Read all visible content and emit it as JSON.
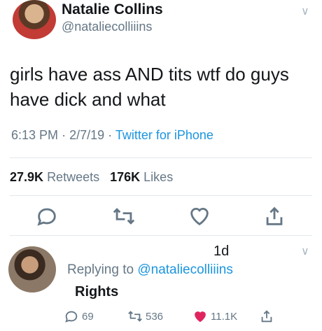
{
  "tweet": {
    "name": "Natalie Collins",
    "handle": "@nataliecolliiins",
    "text": "girls have ass AND tits wtf do guys have dick and what",
    "time": "6:13 PM",
    "sep1": "·",
    "date": "2/7/19",
    "sep2": "·",
    "source": "Twitter for iPhone",
    "retweets_count": "27.9K",
    "retweets_label": "Retweets",
    "likes_count": "176K",
    "likes_label": "Likes"
  },
  "reply": {
    "time": "1d",
    "replying_to_label": "Replying to",
    "replying_to_handle": "@nataliecolliiins",
    "text": "Rights",
    "reply_count": "69",
    "retweet_count": "536",
    "like_count": "11.1K"
  },
  "icons": [
    "reply-icon",
    "retweet-icon",
    "like-icon",
    "share-icon",
    "chevron-down-icon"
  ],
  "colors": {
    "accent": "#1b95e0",
    "muted": "#657786",
    "like": "#e0245e"
  }
}
